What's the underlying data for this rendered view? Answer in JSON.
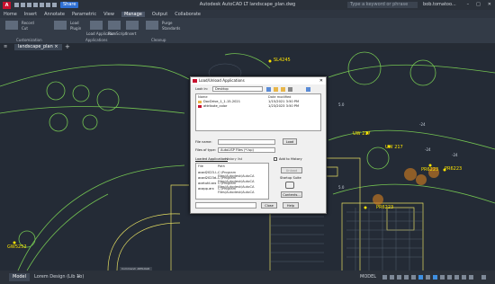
{
  "window": {
    "logo": "A",
    "share": "Share",
    "title": "Autodesk AutoCAD LT  landscape_plan.dwg",
    "search_placeholder": "Type a keyword or phrase",
    "user": "bob.tomatoo...",
    "controls": [
      "–",
      "□",
      "✕"
    ]
  },
  "ribbon": {
    "tabs": [
      "Home",
      "Insert",
      "Annotate",
      "Parametric",
      "View",
      "Manage",
      "Output",
      "Collaborate"
    ],
    "active_tab": "Manage",
    "items": [
      "Record",
      "Cut",
      "Load",
      "Plugin",
      "Load Application",
      "Run Script",
      "Insert",
      "Purge",
      "Standards"
    ],
    "panels": [
      "Customization",
      "Applications",
      "Cleanup"
    ]
  },
  "doc_tab": {
    "label": "landscape_plan",
    "close": "×",
    "add": "+"
  },
  "drawing_labels": {
    "plants": [
      "SL4245",
      "UW 217",
      "UW 217",
      "PR6223",
      "PR6223",
      "PR6223",
      "GW5252"
    ],
    "small": [
      "-24",
      "-24",
      "-24",
      "5.0",
      "5.0"
    ]
  },
  "dialog": {
    "title": "Load/Unload Applications",
    "close": "✕",
    "look_in_label": "Look in:",
    "look_in_value": "Desktop",
    "col_name": "Name",
    "col_date": "Date modified",
    "files": [
      {
        "name": "DocDrive_1_1-15-2021",
        "date": "1/15/2021 3:50 PM"
      },
      {
        "name": "attribute_color",
        "date": "1/23/2023 3:50 PM"
      }
    ],
    "file_name_label": "File name:",
    "file_name_value": "",
    "files_type_label": "Files of type:",
    "files_type_value": "AutoLISP Files (*.lsp)",
    "load_button": "Load",
    "tabs": [
      "Loaded Applications",
      "History list"
    ],
    "add_to_history": "Add to History",
    "unload_button": "Unload",
    "startup_label": "Startup Suite",
    "contents_button": "Contents...",
    "list_headers": [
      "File",
      "Path"
    ],
    "list_items": [
      {
        "file": "acad2023.l...",
        "path": "C:\\Program Files\\Autodesk\\AutoCA"
      },
      {
        "file": "acad2023d...",
        "path": "C:\\Program Files\\Autodesk\\AutoCA"
      },
      {
        "file": "acetutil.arx",
        "path": "C:\\Program Files\\Autodesk\\AutoCA"
      },
      {
        "file": "acapp.arx",
        "path": "C:\\Program Files\\Autodesk\\AutoCA"
      }
    ],
    "close_button": "Close",
    "help_button": "Help"
  },
  "command": {
    "history": "Command: APPLOAD",
    "placeholder": "Type a command"
  },
  "status": {
    "model_tab": "Model",
    "layout_tab": "Lorem Design (Lib 1b)",
    "add": "+",
    "model_label": "MODEL"
  },
  "colors": {
    "accent": "#2e6fd3",
    "brand": "#c8102e",
    "label_yellow": "#ffe600",
    "background": "#242b36"
  }
}
